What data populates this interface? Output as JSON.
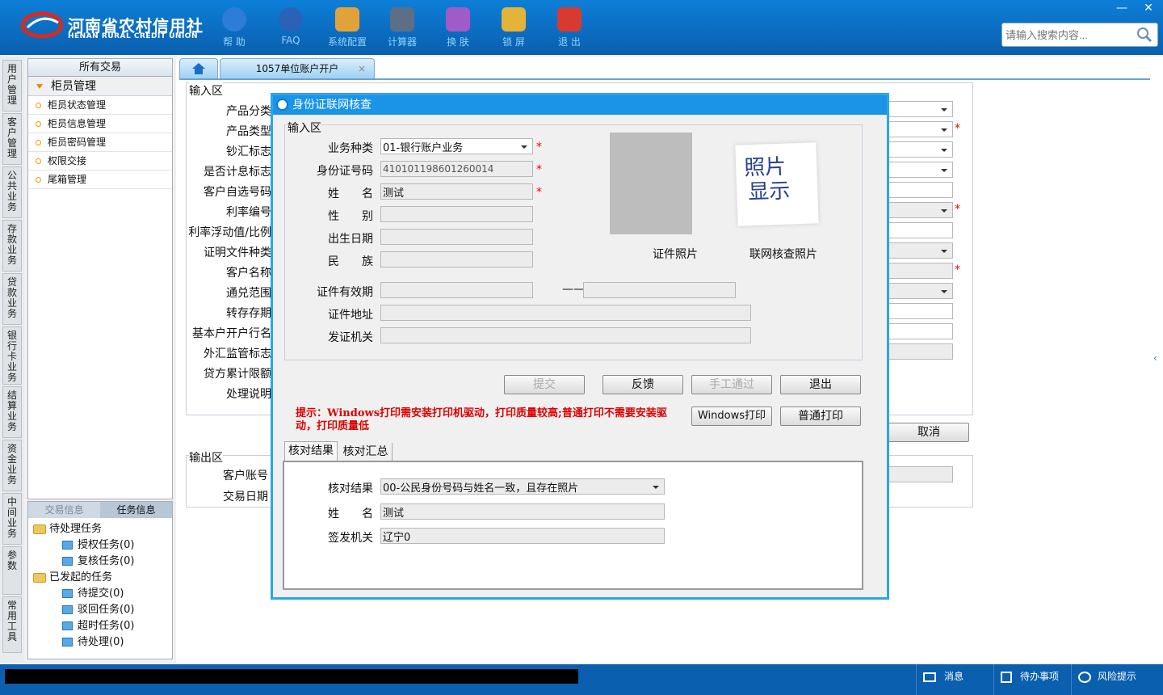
{
  "header": {
    "logo_cn": "河南省农村信用社",
    "logo_en": "HENAN RURAL CREDIT UNION",
    "toolbar": [
      {
        "label": "帮 助",
        "icon": "info-icon",
        "color": "#2d7cd6"
      },
      {
        "label": "FAQ",
        "icon": "question-icon",
        "color": "#2b62b8"
      },
      {
        "label": "系统配置",
        "icon": "toolbox-icon",
        "color": "#e2a23a"
      },
      {
        "label": "计算器",
        "icon": "calculator-icon",
        "color": "#5d6f86"
      },
      {
        "label": "换 肤",
        "icon": "shirt-icon",
        "color": "#a05bc8"
      },
      {
        "label": "锁 屏",
        "icon": "lock-icon",
        "color": "#e3b33a"
      },
      {
        "label": "退 出",
        "icon": "power-icon",
        "color": "#d93a2f"
      }
    ],
    "search_placeholder": "请输入搜索内容...",
    "window_min": "—",
    "window_close": "✕"
  },
  "vtabs": [
    "用户管理",
    "客户管理",
    "公共业务",
    "存款业务",
    "贷款业务",
    "银行卡业务",
    "结算业务",
    "资金业务",
    "中间业务",
    "参数",
    "常用工具"
  ],
  "menu": {
    "header": "所有交易",
    "category": "柜员管理",
    "items": [
      "柜员状态管理",
      "柜员信息管理",
      "柜员密码管理",
      "权限交接",
      "尾箱管理"
    ]
  },
  "task_panel": {
    "tabs": [
      "交易信息",
      "任务信息"
    ],
    "groups": [
      {
        "label": "待处理任务",
        "children": [
          "授权任务(0)",
          "复核任务(0)"
        ]
      },
      {
        "label": "已发起的任务",
        "children": [
          "待提交(0)",
          "驳回任务(0)",
          "超时任务(0)",
          "待处理(0)"
        ]
      }
    ]
  },
  "page_tabs": {
    "home_icon": "home-icon",
    "active": "1057单位账户开户",
    "close": "×"
  },
  "bg_form": {
    "input_section": "输入区",
    "labels": [
      "产品分类",
      "产品类型",
      "钞汇标志",
      "是否计息标志",
      "客户自选号码",
      "利率编号",
      "利率浮动值/比例",
      "证明文件种类",
      "客户名称",
      "通兑范围",
      "转存存期",
      "基本户开户行名",
      "外汇监管标志",
      "贷方累计限额",
      "处理说明"
    ],
    "cancel": "取消",
    "output_section": "输出区",
    "output_labels": [
      "客户账号",
      "交易日期"
    ]
  },
  "dialog": {
    "title": "身份证联网核查",
    "input_section": "输入区",
    "fields": {
      "biz_type": {
        "label": "业务种类",
        "value": "01-银行账户业务"
      },
      "id_no": {
        "label": "身份证号码",
        "value": "410101198601260014"
      },
      "name": {
        "label": "姓　　名",
        "value": "测试"
      },
      "gender": {
        "label": "性　　别",
        "value": ""
      },
      "birth": {
        "label": "出生日期",
        "value": ""
      },
      "ethnic": {
        "label": "民　　族",
        "value": ""
      },
      "validity": {
        "label": "证件有效期",
        "value": "",
        "sep": "——",
        "value2": ""
      },
      "address": {
        "label": "证件地址",
        "value": ""
      },
      "issuer": {
        "label": "发证机关",
        "value": ""
      }
    },
    "star": "*",
    "photo_cert_label": "证件照片",
    "photo_net_label": "联网核查照片",
    "photo_placeholder": [
      "照片",
      "显示"
    ],
    "buttons": {
      "submit": "提交",
      "feedback": "反馈",
      "manual": "手工通过",
      "exit": "退出",
      "win_print": "Windows打印",
      "normal_print": "普通打印"
    },
    "tip": "提示：Windows打印需安装打印机驱动，打印质量较高;普通打印不需要安装驱动，打印质量低",
    "result_tabs": [
      "核对结果",
      "核对汇总"
    ],
    "result": {
      "check": {
        "label": "核对结果",
        "value": "00-公民身份号码与姓名一致，且存在照片"
      },
      "name": {
        "label": "姓　　名",
        "value": "测试"
      },
      "issuer": {
        "label": "签发机关",
        "value": "辽宁0"
      }
    }
  },
  "statusbar": {
    "message": "消息",
    "todo": "待办事项",
    "risk": "风险提示"
  }
}
